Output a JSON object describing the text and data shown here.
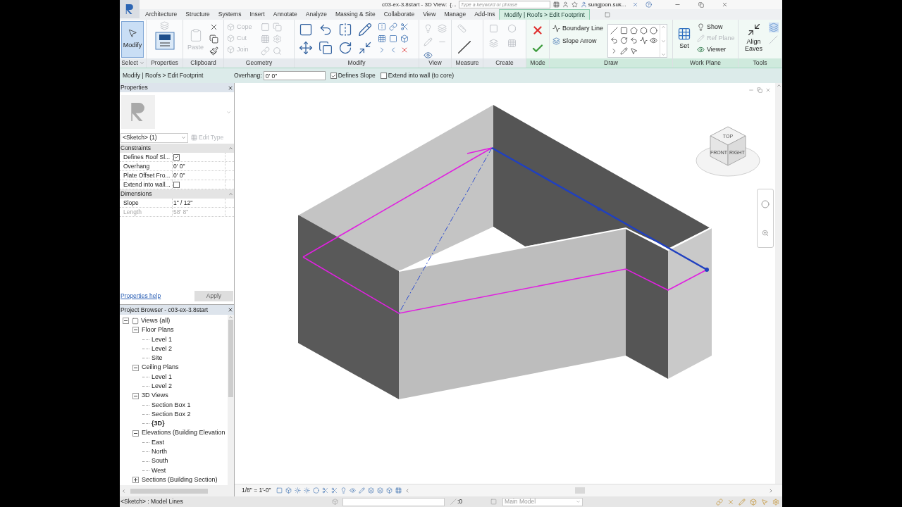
{
  "title_bar": {
    "title": "c03-ex-3.8start - 3D View:",
    "crumb": "{...",
    "search_placeholder": "Type a keyword or phrase",
    "user": "sungjoon.suk..."
  },
  "tabs": [
    {
      "label": "Architecture",
      "selected": false,
      "contextual": false
    },
    {
      "label": "Structure",
      "selected": false,
      "contextual": false
    },
    {
      "label": "Systems",
      "selected": false,
      "contextual": false
    },
    {
      "label": "Insert",
      "selected": false,
      "contextual": false
    },
    {
      "label": "Annotate",
      "selected": false,
      "contextual": false
    },
    {
      "label": "Analyze",
      "selected": false,
      "contextual": false
    },
    {
      "label": "Massing & Site",
      "selected": false,
      "contextual": false
    },
    {
      "label": "Collaborate",
      "selected": false,
      "contextual": false
    },
    {
      "label": "View",
      "selected": false,
      "contextual": false
    },
    {
      "label": "Manage",
      "selected": false,
      "contextual": false
    },
    {
      "label": "Add-Ins",
      "selected": false,
      "contextual": false
    },
    {
      "label": "Modify | Roofs > Edit Footprint",
      "selected": true,
      "contextual": true
    }
  ],
  "ribbon_groups": [
    {
      "kind": "select",
      "label": "Select",
      "contextual": false,
      "tools": [
        {
          "label": "Modify",
          "selected": true,
          "disabled": false
        }
      ]
    },
    {
      "kind": "properties",
      "label": "Properties",
      "contextual": false
    },
    {
      "kind": "clipboard",
      "label": "Clipboard",
      "contextual": false,
      "tools": [
        {
          "label": "Paste",
          "disabled": true
        }
      ]
    },
    {
      "kind": "geometry",
      "label": "Geometry",
      "contextual": false,
      "tools": [
        {
          "label": "Cope",
          "disabled": true
        },
        {
          "label": "Cut",
          "disabled": true
        },
        {
          "label": "Join",
          "disabled": true
        }
      ]
    },
    {
      "kind": "modify",
      "label": "Modify",
      "contextual": false
    },
    {
      "kind": "view",
      "label": "View",
      "contextual": false
    },
    {
      "kind": "measure",
      "label": "Measure",
      "contextual": false
    },
    {
      "kind": "create",
      "label": "Create",
      "contextual": false
    },
    {
      "kind": "mode",
      "label": "Mode",
      "contextual": true
    },
    {
      "kind": "draw",
      "label": "Draw",
      "contextual": true,
      "tools": [
        {
          "label": "Boundary Line",
          "disabled": false
        },
        {
          "label": "Slope Arrow",
          "disabled": false
        }
      ]
    },
    {
      "kind": "work_plane",
      "label": "Work Plane",
      "contextual": true,
      "tools": [
        {
          "label": "Set",
          "disabled": false
        },
        {
          "label": "Show",
          "disabled": false
        },
        {
          "label": "Ref Plane",
          "disabled": true
        },
        {
          "label": "Viewer",
          "disabled": false
        }
      ]
    },
    {
      "kind": "tools",
      "label": "Tools",
      "contextual": true,
      "tools": [
        {
          "label": "Align Eaves",
          "disabled": false
        }
      ]
    }
  ],
  "options_bar": {
    "context": "Modify | Roofs > Edit Footprint",
    "overhang_label": "Overhang:",
    "overhang_value": "0' 0\"",
    "checkboxes": [
      {
        "label": "Defines Slope",
        "checked": true
      },
      {
        "label": "Extend into wall (to core)",
        "checked": false
      }
    ]
  },
  "properties": {
    "title": "Properties",
    "type_selector": "<Sketch> (1)",
    "edit_type": {
      "label": "Edit Type",
      "disabled": true
    },
    "sections": [
      {
        "name": "Constraints",
        "rows": [
          {
            "label": "Defines Roof Sl...",
            "kind": "check",
            "checked": true,
            "disabled": false
          },
          {
            "label": "Overhang",
            "kind": "text",
            "value": "0' 0\"",
            "disabled": false
          },
          {
            "label": "Plate Offset Fro...",
            "kind": "text",
            "value": "0' 0\"",
            "disabled": false
          },
          {
            "label": "Extend into wall...",
            "kind": "check",
            "checked": false,
            "disabled": false
          }
        ]
      },
      {
        "name": "Dimensions",
        "rows": [
          {
            "label": "Slope",
            "kind": "text",
            "value": "1\" / 12\"",
            "disabled": false
          },
          {
            "label": "Length",
            "kind": "text",
            "value": "58' 8\"",
            "disabled": true
          }
        ]
      }
    ],
    "help_link": "Properties help",
    "apply": {
      "label": "Apply",
      "disabled": true
    }
  },
  "project_browser": {
    "title": "Project Browser - c03-ex-3.8start",
    "tree": [
      {
        "label": "Views (all)",
        "expanded": true,
        "current": false,
        "children": [
          {
            "label": "Floor Plans",
            "expanded": true,
            "current": false,
            "children": [
              {
                "label": "Level 1",
                "current": false
              },
              {
                "label": "Level 2",
                "current": false
              },
              {
                "label": "Site",
                "current": false
              }
            ]
          },
          {
            "label": "Ceiling Plans",
            "expanded": true,
            "current": false,
            "children": [
              {
                "label": "Level 1",
                "current": false
              },
              {
                "label": "Level 2",
                "current": false
              }
            ]
          },
          {
            "label": "3D Views",
            "expanded": true,
            "current": false,
            "children": [
              {
                "label": "Section Box 1",
                "current": false
              },
              {
                "label": "Section Box 2",
                "current": false
              },
              {
                "label": "{3D}",
                "current": true
              }
            ]
          },
          {
            "label": "Elevations (Building Elevation",
            "expanded": true,
            "current": false,
            "children": [
              {
                "label": "East",
                "current": false
              },
              {
                "label": "North",
                "current": false
              },
              {
                "label": "South",
                "current": false
              },
              {
                "label": "West",
                "current": false
              }
            ]
          },
          {
            "label": "Sections (Building Section)",
            "expanded": false,
            "current": false
          }
        ]
      }
    ]
  },
  "view_cube": {
    "faces": [
      "TOP",
      "FRONT",
      "RIGHT"
    ]
  },
  "view_control_bar": {
    "scale": "1/8\" = 1'-0\""
  },
  "status_bar": {
    "text": "<Sketch> : Model Lines",
    "selection_count": ":0",
    "model": "Main Model"
  }
}
